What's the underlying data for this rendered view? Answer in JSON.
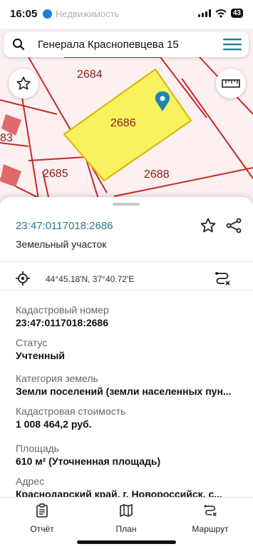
{
  "status": {
    "time": "16:05",
    "faded_app": "Недвижимость",
    "battery": "43"
  },
  "search": {
    "query": "Генерала Краснопевцева 15"
  },
  "map": {
    "plots": [
      "2684",
      "2686",
      "2685",
      "2688",
      "83"
    ]
  },
  "parcel": {
    "cadastral_header": "23:47:0117018:2686",
    "type": "Земельный участок",
    "coordinates": "44°45.18'N, 37°40.72'E"
  },
  "fields": [
    {
      "label": "Кадастровый номер",
      "value": "23:47:0117018:2686"
    },
    {
      "label": "Статус",
      "value": "Учтенный"
    },
    {
      "label": "Категория земель",
      "value": "Земли поселений (земли населенных пун..."
    },
    {
      "label": "Кадастровая стоимость",
      "value": "1 008 464,2 руб."
    },
    {
      "label": "Площадь",
      "value": "610 м² (Уточненная площадь)"
    },
    {
      "label": "Адрес",
      "value": "Краснодарский край, г. Новороссийск, с..."
    }
  ],
  "tabs": [
    {
      "label": "Отчёт",
      "icon": "report-icon"
    },
    {
      "label": "План",
      "icon": "map-plan-icon"
    },
    {
      "label": "Маршрут",
      "icon": "route-icon"
    }
  ],
  "colors": {
    "accent": "#2a7a8c",
    "pin": "#1f86b0",
    "plot_fill": "#f7f25e",
    "boundary": "#c62828"
  }
}
